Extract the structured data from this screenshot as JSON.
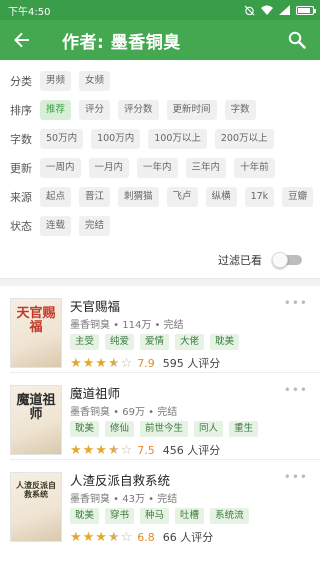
{
  "status": {
    "time": "下午4:50",
    "icons": [
      "alarm-off-icon",
      "wifi-icon",
      "signal-icon",
      "battery-icon"
    ]
  },
  "toolbar": {
    "title": "作者: 墨香铜臭"
  },
  "filters": [
    {
      "label": "分类",
      "options": [
        "男频",
        "女频"
      ],
      "active": -1
    },
    {
      "label": "排序",
      "options": [
        "推荐",
        "评分",
        "评分数",
        "更新时间",
        "字数"
      ],
      "active": 0
    },
    {
      "label": "字数",
      "options": [
        "50万内",
        "100万内",
        "100万以上",
        "200万以上"
      ],
      "active": -1
    },
    {
      "label": "更新",
      "options": [
        "一周内",
        "一月内",
        "一年内",
        "三年内",
        "十年前"
      ],
      "active": -1
    },
    {
      "label": "来源",
      "options": [
        "起点",
        "晋江",
        "刺猬猫",
        "飞卢",
        "纵横",
        "17k",
        "豆瓣"
      ],
      "active": -1
    },
    {
      "label": "状态",
      "options": [
        "连载",
        "完结"
      ],
      "active": -1
    }
  ],
  "toggle": {
    "label": "过滤已看",
    "on": false
  },
  "books": [
    {
      "title": "天官赐福",
      "meta": "墨香铜臭 • 114万 • 完结",
      "tags": [
        "主受",
        "纯爱",
        "爱情",
        "大佬",
        "耽美"
      ],
      "stars": 3.5,
      "score": "7.9",
      "raters": "595 人评分",
      "cover_text": "天官赐福",
      "cover_color": "#c0392b"
    },
    {
      "title": "魔道祖师",
      "meta": "墨香铜臭 • 69万 • 完结",
      "tags": [
        "耽美",
        "修仙",
        "前世今生",
        "同人",
        "重生"
      ],
      "stars": 3.5,
      "score": "7.5",
      "raters": "456 人评分",
      "cover_text": "魔道祖师",
      "cover_color": "#2c2c2c"
    },
    {
      "title": "人渣反派自救系统",
      "meta": "墨香铜臭 • 43万 • 完结",
      "tags": [
        "耽美",
        "穿书",
        "种马",
        "吐槽",
        "系统流"
      ],
      "stars": 3.5,
      "score": "6.8",
      "raters": "66 人评分",
      "cover_text": "人渣反派自救系统",
      "cover_color": "#3a3a2a"
    }
  ]
}
